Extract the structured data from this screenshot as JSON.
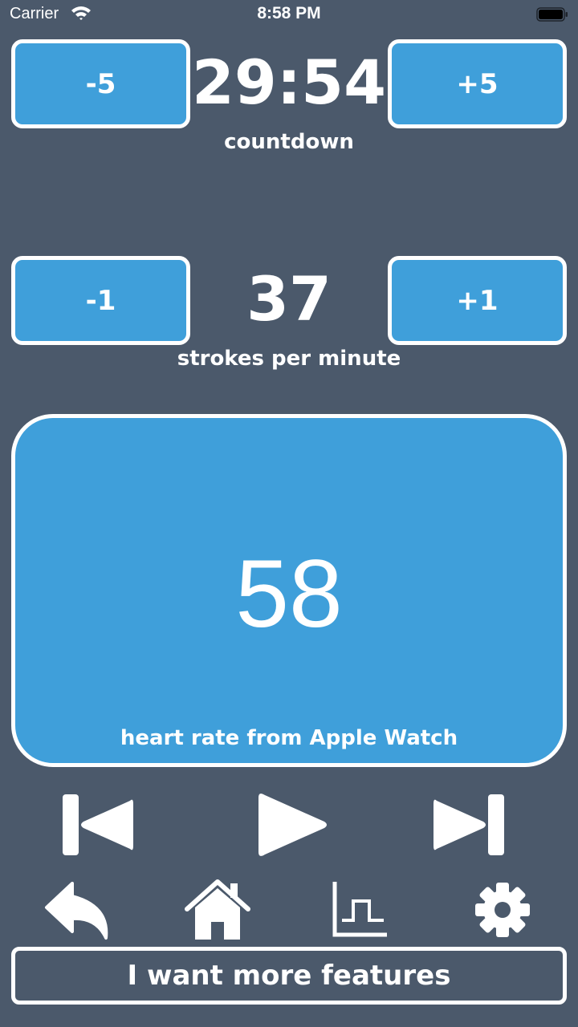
{
  "status_bar": {
    "carrier": "Carrier",
    "time": "8:58 PM"
  },
  "countdown": {
    "minus_label": "-5",
    "value": "29:54",
    "plus_label": "+5",
    "caption": "countdown"
  },
  "stroke_rate": {
    "minus_label": "-1",
    "value": "37",
    "plus_label": "+1",
    "caption": "strokes per minute"
  },
  "heart_rate": {
    "value": "58",
    "caption": "heart rate from Apple Watch"
  },
  "transport": {
    "icons": [
      "skip-back-icon",
      "play-icon",
      "skip-forward-icon"
    ]
  },
  "toolbar": {
    "icons": [
      "back-arrow-icon",
      "home-icon",
      "chart-icon",
      "gear-icon"
    ]
  },
  "features_button": {
    "label": "I want more features"
  },
  "colors": {
    "background": "#4b596b",
    "accent": "#3f9fda",
    "foreground": "#ffffff"
  }
}
